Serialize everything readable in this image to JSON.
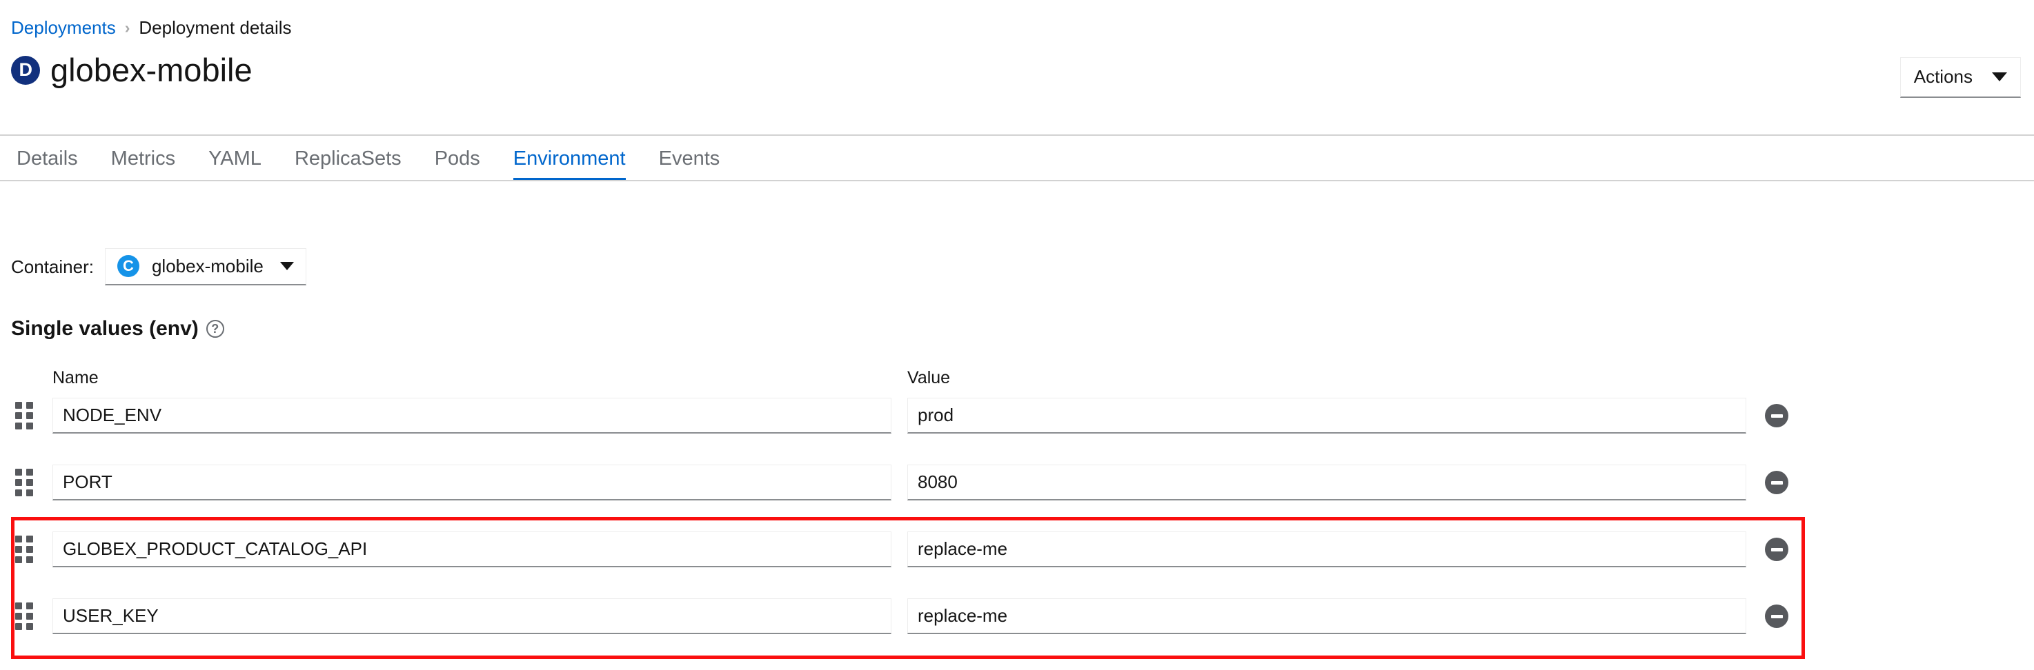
{
  "breadcrumb": {
    "parent": "Deployments",
    "separator": "›",
    "current": "Deployment details"
  },
  "header": {
    "badge_letter": "D",
    "badge_color": "#11307d",
    "title": "globex-mobile",
    "actions_label": "Actions",
    "actions_caret": "caret-down-icon"
  },
  "tabs": [
    {
      "label": "Details",
      "active": false
    },
    {
      "label": "Metrics",
      "active": false
    },
    {
      "label": "YAML",
      "active": false
    },
    {
      "label": "ReplicaSets",
      "active": false
    },
    {
      "label": "Pods",
      "active": false
    },
    {
      "label": "Environment",
      "active": true
    },
    {
      "label": "Events",
      "active": false
    }
  ],
  "container_selector": {
    "label": "Container:",
    "badge_letter": "C",
    "badge_color": "#1593e8",
    "selected": "globex-mobile"
  },
  "section": {
    "title": "Single values (env)",
    "help_icon": "?"
  },
  "env_table": {
    "columns": {
      "name": "Name",
      "value": "Value"
    },
    "rows": [
      {
        "name": "NODE_ENV",
        "value": "prod",
        "highlighted": false
      },
      {
        "name": "PORT",
        "value": "8080",
        "highlighted": false
      },
      {
        "name": "GLOBEX_PRODUCT_CATALOG_API",
        "value": "replace-me",
        "highlighted": true
      },
      {
        "name": "USER_KEY",
        "value": "replace-me",
        "highlighted": true
      }
    ],
    "remove_icon": "minus-circle-icon",
    "drag_icon": "drag-handle-icon"
  },
  "annotation": {
    "color": "#fa0f0f",
    "targets": [
      "GLOBEX_PRODUCT_CATALOG_API",
      "USER_KEY"
    ]
  }
}
